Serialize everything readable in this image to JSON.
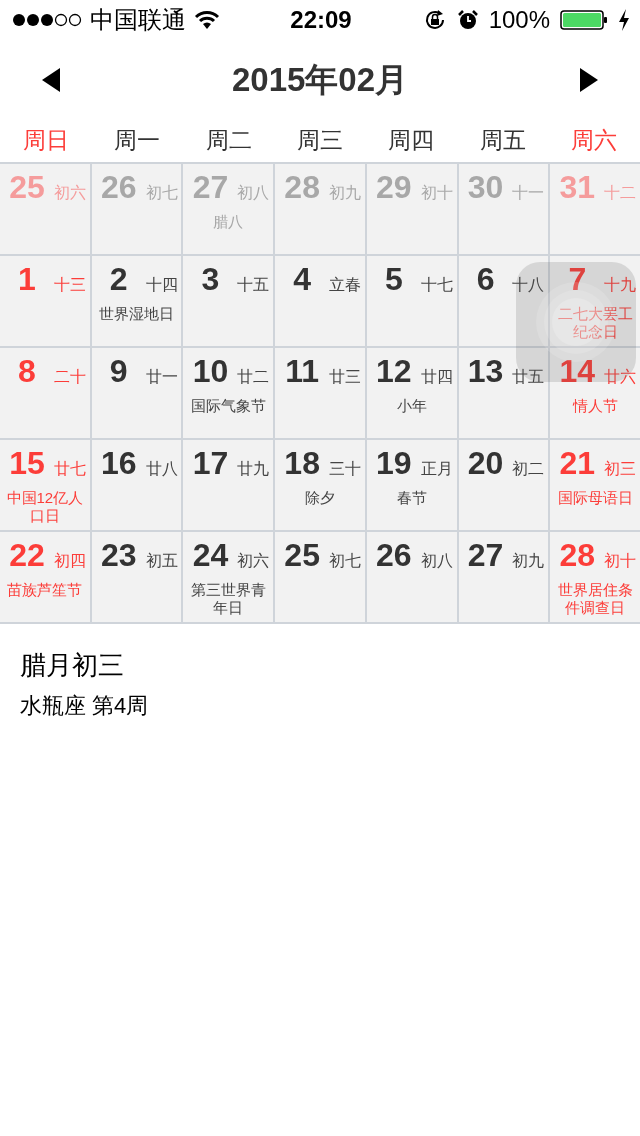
{
  "status_bar": {
    "carrier": "中国联通",
    "time": "22:09",
    "battery": "100%"
  },
  "header": {
    "title": "2015年02月"
  },
  "weekdays": [
    {
      "label": "周日",
      "weekend": true
    },
    {
      "label": "周一",
      "weekend": false
    },
    {
      "label": "周二",
      "weekend": false
    },
    {
      "label": "周三",
      "weekend": false
    },
    {
      "label": "周四",
      "weekend": false
    },
    {
      "label": "周五",
      "weekend": false
    },
    {
      "label": "周六",
      "weekend": true
    }
  ],
  "weeks": [
    [
      {
        "day": "25",
        "lunar": "初六",
        "other_month": true,
        "weekend": true
      },
      {
        "day": "26",
        "lunar": "初七",
        "other_month": true,
        "weekend": false
      },
      {
        "day": "27",
        "lunar": "初八",
        "festival": "腊八",
        "other_month": true,
        "weekend": false
      },
      {
        "day": "28",
        "lunar": "初九",
        "other_month": true,
        "weekend": false
      },
      {
        "day": "29",
        "lunar": "初十",
        "other_month": true,
        "weekend": false
      },
      {
        "day": "30",
        "lunar": "十一",
        "other_month": true,
        "weekend": false
      },
      {
        "day": "31",
        "lunar": "十二",
        "other_month": true,
        "weekend": true
      }
    ],
    [
      {
        "day": "1",
        "lunar": "十三",
        "other_month": false,
        "weekend": true
      },
      {
        "day": "2",
        "lunar": "十四",
        "festival": "世界湿地日",
        "other_month": false,
        "weekend": false
      },
      {
        "day": "3",
        "lunar": "十五",
        "other_month": false,
        "weekend": false
      },
      {
        "day": "4",
        "lunar": "立春",
        "other_month": false,
        "weekend": false
      },
      {
        "day": "5",
        "lunar": "十七",
        "other_month": false,
        "weekend": false
      },
      {
        "day": "6",
        "lunar": "十八",
        "other_month": false,
        "weekend": false
      },
      {
        "day": "7",
        "lunar": "十九",
        "festival": "二七大罢工纪念日",
        "other_month": false,
        "weekend": true
      }
    ],
    [
      {
        "day": "8",
        "lunar": "二十",
        "other_month": false,
        "weekend": true
      },
      {
        "day": "9",
        "lunar": "廿一",
        "other_month": false,
        "weekend": false
      },
      {
        "day": "10",
        "lunar": "廿二",
        "festival": "国际气象节",
        "other_month": false,
        "weekend": false
      },
      {
        "day": "11",
        "lunar": "廿三",
        "other_month": false,
        "weekend": false
      },
      {
        "day": "12",
        "lunar": "廿四",
        "festival": "小年",
        "other_month": false,
        "weekend": false
      },
      {
        "day": "13",
        "lunar": "廿五",
        "other_month": false,
        "weekend": false
      },
      {
        "day": "14",
        "lunar": "廿六",
        "festival": "情人节",
        "other_month": false,
        "weekend": true
      }
    ],
    [
      {
        "day": "15",
        "lunar": "廿七",
        "festival": "中国12亿人口日",
        "other_month": false,
        "weekend": true
      },
      {
        "day": "16",
        "lunar": "廿八",
        "other_month": false,
        "weekend": false
      },
      {
        "day": "17",
        "lunar": "廿九",
        "other_month": false,
        "weekend": false
      },
      {
        "day": "18",
        "lunar": "三十",
        "festival": "除夕",
        "other_month": false,
        "weekend": false
      },
      {
        "day": "19",
        "lunar": "正月",
        "festival": "春节",
        "other_month": false,
        "weekend": false
      },
      {
        "day": "20",
        "lunar": "初二",
        "other_month": false,
        "weekend": false
      },
      {
        "day": "21",
        "lunar": "初三",
        "festival": "国际母语日",
        "other_month": false,
        "weekend": true
      }
    ],
    [
      {
        "day": "22",
        "lunar": "初四",
        "festival": "苗族芦笙节",
        "other_month": false,
        "weekend": true
      },
      {
        "day": "23",
        "lunar": "初五",
        "other_month": false,
        "weekend": false
      },
      {
        "day": "24",
        "lunar": "初六",
        "festival": "第三世界青年日",
        "other_month": false,
        "weekend": false
      },
      {
        "day": "25",
        "lunar": "初七",
        "other_month": false,
        "weekend": false
      },
      {
        "day": "26",
        "lunar": "初八",
        "other_month": false,
        "weekend": false
      },
      {
        "day": "27",
        "lunar": "初九",
        "other_month": false,
        "weekend": false
      },
      {
        "day": "28",
        "lunar": "初十",
        "festival": "世界居住条件调查日",
        "other_month": false,
        "weekend": true
      }
    ]
  ],
  "info": {
    "lunar_date": "腊月初三",
    "detail": "水瓶座 第4周"
  }
}
